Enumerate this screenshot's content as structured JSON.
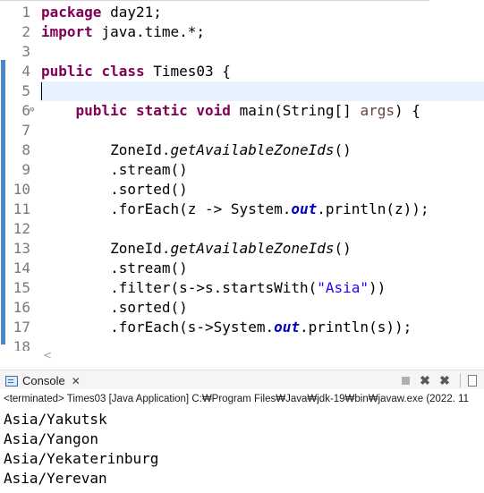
{
  "editor": {
    "line_numbers": [
      "1",
      "2",
      "3",
      "4",
      "5",
      "6",
      "7",
      "8",
      "9",
      "10",
      "11",
      "12",
      "13",
      "14",
      "15",
      "16",
      "17",
      "18"
    ],
    "fold_marker": "⊖",
    "lines": {
      "l1": {
        "kw": "package",
        "rest": " day21;"
      },
      "l2": {
        "kw": "import",
        "rest": " java.time.*;"
      },
      "l4": {
        "kw1": "public",
        "kw2": "class",
        "rest": " Times03 {"
      },
      "l6": {
        "kw1": "public",
        "kw2": "static",
        "kw3": "void",
        "a": " main(String[] ",
        "param": "args",
        "b": ") {"
      },
      "l8": {
        "a": "ZoneId.",
        "it": "getAvailableZoneIds",
        "b": "()"
      },
      "l9": {
        "a": ".stream()"
      },
      "l10": {
        "a": ".sorted()"
      },
      "l11": {
        "a": ".forEach(z -> System.",
        "fld": "out",
        "b": ".println(z));"
      },
      "l13": {
        "a": "ZoneId.",
        "it": "getAvailableZoneIds",
        "b": "()"
      },
      "l14": {
        "a": ".stream()"
      },
      "l15": {
        "a": ".filter(s->s.startsWith(",
        "str": "\"Asia\"",
        "b": "))"
      },
      "l16": {
        "a": ".sorted()"
      },
      "l17": {
        "a": ".forEach(s->System.",
        "fld": "out",
        "b": ".println(s));"
      }
    },
    "scroll_left_glyph": "<"
  },
  "console": {
    "tab_label": "Console",
    "close_glyph": "✕",
    "status": "<terminated> Times03 [Java Application] C:₩Program Files₩Java₩jdk-19₩bin₩javaw.exe  (2022. 11",
    "output": [
      "Asia/Yakutsk",
      "Asia/Yangon",
      "Asia/Yekaterinburg",
      "Asia/Yerevan"
    ]
  },
  "toolbar_icons": [
    "terminate-icon",
    "remove-launch-icon",
    "remove-all-terminated-icon",
    "clear-console-icon"
  ]
}
